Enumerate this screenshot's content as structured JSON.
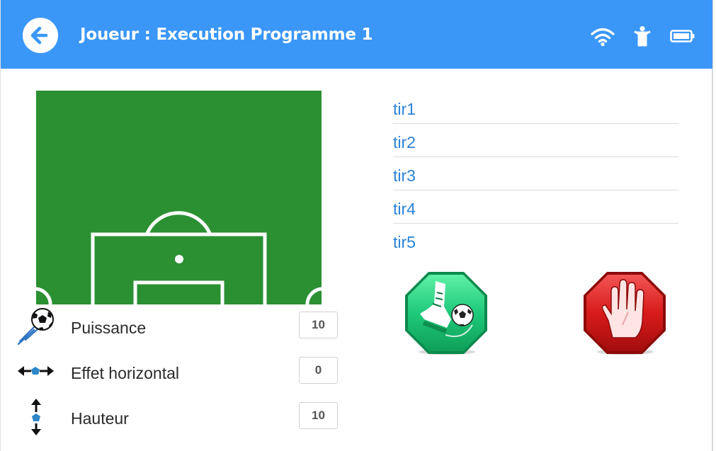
{
  "header": {
    "title": "Joueur : Execution Programme 1",
    "bg_color": "#3a97f8",
    "back_icon": "arrow-left-icon",
    "status_icons": [
      "wifi-icon",
      "person-icon",
      "battery-icon"
    ]
  },
  "field": {
    "color": "#2b9032",
    "line_color": "#ffffff"
  },
  "params": [
    {
      "label": "Puissance",
      "value": "10",
      "icon": "ball-shot-icon"
    },
    {
      "label": "Effet horizontal",
      "value": "0",
      "icon": "horizontal-arrows-icon"
    },
    {
      "label": "Hauteur",
      "value": "10",
      "icon": "vertical-arrows-icon"
    }
  ],
  "shots": [
    {
      "label": "tir1"
    },
    {
      "label": "tir2"
    },
    {
      "label": "tir3"
    },
    {
      "label": "tir4"
    },
    {
      "label": "tir5"
    }
  ],
  "actions": {
    "kick_icon": "kick-icon",
    "kick_color": "#1fc97a",
    "stop_icon": "stop-hand-icon",
    "stop_color": "#d81b1b"
  }
}
